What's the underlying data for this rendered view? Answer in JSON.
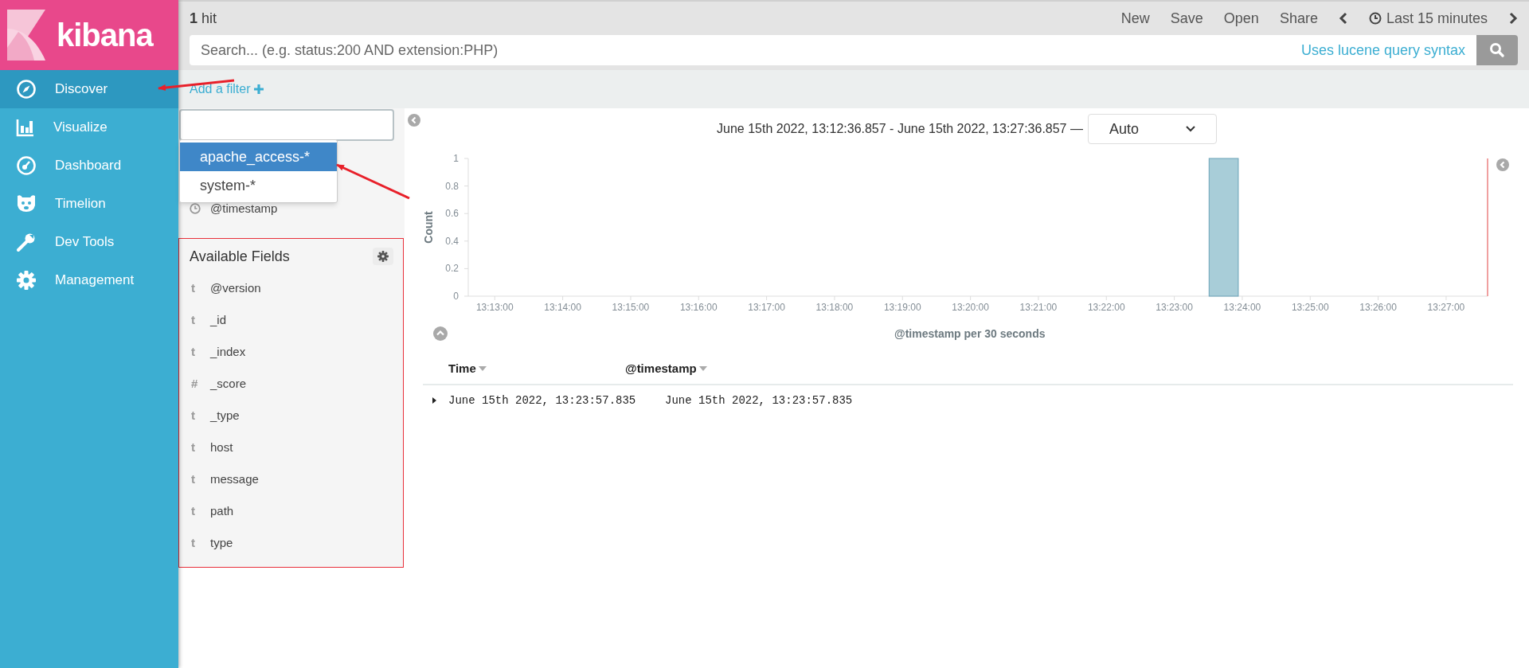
{
  "sidebar": {
    "logo_text": "kibana",
    "items": [
      {
        "label": "Discover",
        "selected": true
      },
      {
        "label": "Visualize",
        "selected": false
      },
      {
        "label": "Dashboard",
        "selected": false
      },
      {
        "label": "Timelion",
        "selected": false
      },
      {
        "label": "Dev Tools",
        "selected": false
      },
      {
        "label": "Management",
        "selected": false
      }
    ]
  },
  "top_bar": {
    "hits_count": "1",
    "hits_label": "hit",
    "actions": [
      "New",
      "Save",
      "Open",
      "Share"
    ],
    "time_picker": "Last 15 minutes"
  },
  "search": {
    "placeholder": "Search... (e.g. status:200 AND extension:PHP)",
    "syntax_link": "Uses lucene query syntax"
  },
  "filter_bar": {
    "add_filter": "Add a filter"
  },
  "index_pattern": {
    "options": [
      {
        "label": "apache_access-*",
        "selected": true
      },
      {
        "label": "system-*",
        "selected": false
      }
    ]
  },
  "selected_fields": [
    {
      "name": "@timestamp",
      "kind": "date"
    }
  ],
  "available_fields": {
    "title": "Available Fields",
    "fields": [
      {
        "type_label": "t",
        "name": "@version"
      },
      {
        "type_label": "t",
        "name": "_id"
      },
      {
        "type_label": "t",
        "name": "_index"
      },
      {
        "type_label": "#",
        "name": "_score"
      },
      {
        "type_label": "t",
        "name": "_type"
      },
      {
        "type_label": "t",
        "name": "host"
      },
      {
        "type_label": "t",
        "name": "message"
      },
      {
        "type_label": "t",
        "name": "path"
      },
      {
        "type_label": "t",
        "name": "type"
      }
    ]
  },
  "time_range": {
    "text": "June 15th 2022, 13:12:36.857 - June 15th 2022, 13:27:36.857 —",
    "interval": "Auto"
  },
  "histogram": {
    "chart_data": {
      "type": "bar",
      "xlabel": "@timestamp per 30 seconds",
      "ylabel": "Count",
      "categories": [
        null,
        "13:13:00",
        null,
        "13:14:00",
        null,
        "13:15:00",
        null,
        "13:16:00",
        null,
        "13:17:00",
        null,
        "13:18:00",
        null,
        "13:19:00",
        null,
        "13:20:00",
        null,
        "13:21:00",
        null,
        "13:22:00",
        null,
        "13:23:00",
        null,
        "13:24:00",
        null,
        "13:25:00",
        null,
        "13:26:00",
        null,
        "13:27:00",
        null
      ],
      "values": [
        0,
        0,
        0,
        0,
        0,
        0,
        0,
        0,
        0,
        0,
        0,
        0,
        0,
        0,
        0,
        0,
        0,
        0,
        0,
        0,
        0,
        0,
        1,
        0,
        0,
        0,
        0,
        0,
        0,
        0,
        0
      ],
      "ylim": [
        0,
        1
      ],
      "yticks": [
        0,
        0.2,
        0.4,
        0.6,
        0.8,
        1
      ]
    }
  },
  "table": {
    "columns": [
      {
        "label": "Time"
      },
      {
        "label": "@timestamp"
      }
    ],
    "rows": [
      {
        "expanded": false,
        "cells": [
          "June 15th 2022, 13:23:57.835",
          "June 15th 2022, 13:23:57.835"
        ]
      }
    ]
  }
}
